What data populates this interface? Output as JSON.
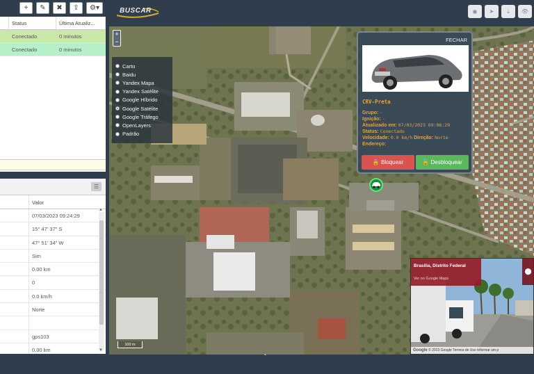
{
  "left_table": {
    "headers": [
      "",
      "Status",
      "Última Atualiz..."
    ],
    "rows": [
      {
        "status": "Conectado",
        "update": "0 minutos",
        "bg": "#c9e8a8"
      },
      {
        "status": "Conectado",
        "update": "0 minutos",
        "bg": "#b5f0c8"
      }
    ]
  },
  "detail_table": {
    "header_value": "Valor",
    "rows": [
      "07/03/2023 09:24:29",
      "15° 47' 37\" S",
      "47° 51' 34\" W",
      "Sim",
      "0.00 km",
      "0",
      "0.0 km/h",
      "Norte",
      "",
      "gps103",
      "0.00 km"
    ]
  },
  "header": {
    "logo_text": "BUSCAR",
    "logo_sub": "BUSCAR"
  },
  "layers": [
    {
      "label": "Carto",
      "selected": false
    },
    {
      "label": "Baidu",
      "selected": false
    },
    {
      "label": "Yandex Mapa",
      "selected": false
    },
    {
      "label": "Yandex Satélite",
      "selected": false
    },
    {
      "label": "Google Híbrido",
      "selected": false
    },
    {
      "label": "Google Satélite",
      "selected": true
    },
    {
      "label": "Google Tráfego",
      "selected": false
    },
    {
      "label": "OpenLayers",
      "selected": false
    },
    {
      "label": "Padrão",
      "selected": false
    }
  ],
  "popup": {
    "close": "FECHAR",
    "title": "CRV-Preta",
    "fields": [
      {
        "label": "Grupo:",
        "value": "-"
      },
      {
        "label": "Ignição:",
        "value": "-"
      },
      {
        "label": "Atualizado em:",
        "value": "07/03/2023 09:06:29"
      },
      {
        "label": "Status:",
        "value": "Conectado"
      },
      {
        "label": "Velocidade:",
        "value": "0.0 km/h",
        "label2": "Direção:",
        "value2": "Norte"
      },
      {
        "label": "Endereço:",
        "value": ""
      }
    ],
    "block_btn": "Bloquear",
    "unblock_btn": "Desbloquear"
  },
  "streetview": {
    "title": "Brasília, Distrito Federal",
    "link": "Ver no Google Maps",
    "footer": "© 2023 Google  Termos de Uso  Informar um p",
    "google": "Google"
  },
  "map": {
    "zoom_in": "+",
    "zoom_out": "−",
    "scale": "100 m"
  }
}
